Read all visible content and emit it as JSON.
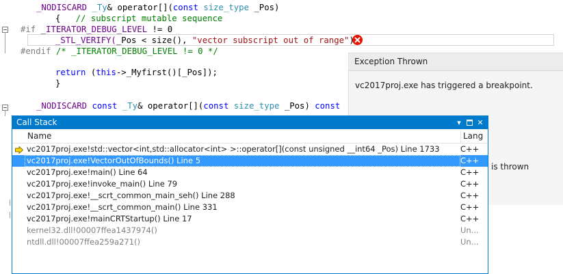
{
  "editor": {
    "lines": [
      {
        "y": 0
      },
      {
        "y": 0
      }
    ],
    "code": {
      "l1_a": "_NODISCARD ",
      "l1_b": "_Ty",
      "l1_c": "& operator[](",
      "l1_d": "const",
      "l1_e": " ",
      "l1_f": "size_type",
      "l1_g": " _Pos)",
      "l2_a": "{   ",
      "l2_b": "// subscript mutable sequence",
      "l3_a": "#if ",
      "l3_b": "_ITERATOR_DEBUG_LEVEL",
      "l3_c": " != 0",
      "l4_a": "_STL_VERIFY(",
      "l4_b": "_Pos < size(), ",
      "l4_c": "\"vector subscript out of range\"",
      "l4_d": ");",
      "l5_a": "#endif ",
      "l5_b": "/* _ITERATOR_DEBUG_LEVEL != 0 */",
      "l7_a": "return",
      "l7_b": " (",
      "l7_c": "this",
      "l7_d": "->_Myfirst()[_Pos]);",
      "l8_a": "}",
      "l10_a": "_NODISCARD ",
      "l10_b": "const",
      "l10_c": " _Ty",
      "l10_d": "& operator[](",
      "l10_e": "const",
      "l10_f": " size_type",
      "l10_g": " _Pos) ",
      "l10_h": "const"
    }
  },
  "exception": {
    "title": "Exception Thrown",
    "message": "vc2017proj.exe has triggered a breakpoint.",
    "partial_text": "is thrown"
  },
  "callstack": {
    "title": "Call Stack",
    "col_name": "Name",
    "col_lang": "Lang",
    "rows": [
      {
        "name": "vc2017proj.exe!std::vector<int,std::allocator<int> >::operator[](const unsigned __int64 _Pos) Line 1733",
        "lang": "C++",
        "state": "current"
      },
      {
        "name": "vc2017proj.exe!VectorOutOfBounds() Line 5",
        "lang": "C++",
        "state": "selected"
      },
      {
        "name": "vc2017proj.exe!main() Line 64",
        "lang": "C++",
        "state": "normal"
      },
      {
        "name": "vc2017proj.exe!invoke_main() Line 79",
        "lang": "C++",
        "state": "normal"
      },
      {
        "name": "vc2017proj.exe!__scrt_common_main_seh() Line 288",
        "lang": "C++",
        "state": "normal"
      },
      {
        "name": "vc2017proj.exe!__scrt_common_main() Line 331",
        "lang": "C++",
        "state": "normal"
      },
      {
        "name": "vc2017proj.exe!mainCRTStartup() Line 17",
        "lang": "C++",
        "state": "normal"
      },
      {
        "name": "kernel32.dll!00007ffea1437974()",
        "lang": "Un...",
        "state": "external"
      },
      {
        "name": "ntdll.dll!00007ffea259a271()",
        "lang": "Un...",
        "state": "external"
      }
    ]
  },
  "colors": {
    "accent": "#007acc",
    "selection": "#3399ff",
    "error": "#e51400",
    "arrow": "#ffd700"
  },
  "icons": {
    "error": "error-icon",
    "current_frame": "current-frame-arrow-icon",
    "dropdown": "dropdown-icon",
    "maximize": "maximize-icon",
    "close": "close-icon"
  }
}
